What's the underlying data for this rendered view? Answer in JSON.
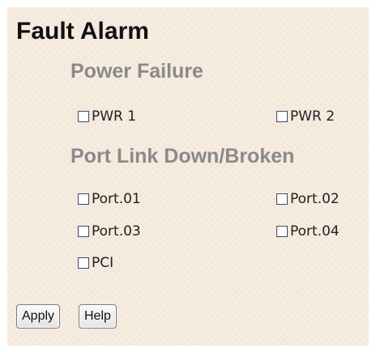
{
  "page": {
    "title": "Fault Alarm"
  },
  "power_failure": {
    "heading": "Power Failure",
    "items": [
      {
        "label": "PWR 1",
        "checked": false
      },
      {
        "label": "PWR 2",
        "checked": false
      }
    ]
  },
  "port_link": {
    "heading": "Port Link Down/Broken",
    "items": [
      {
        "label": "Port.01",
        "checked": false
      },
      {
        "label": "Port.02",
        "checked": false
      },
      {
        "label": "Port.03",
        "checked": false
      },
      {
        "label": "Port.04",
        "checked": false
      },
      {
        "label": "PCI",
        "checked": false
      }
    ]
  },
  "buttons": {
    "apply_label": "Apply",
    "help_label": "Help"
  }
}
